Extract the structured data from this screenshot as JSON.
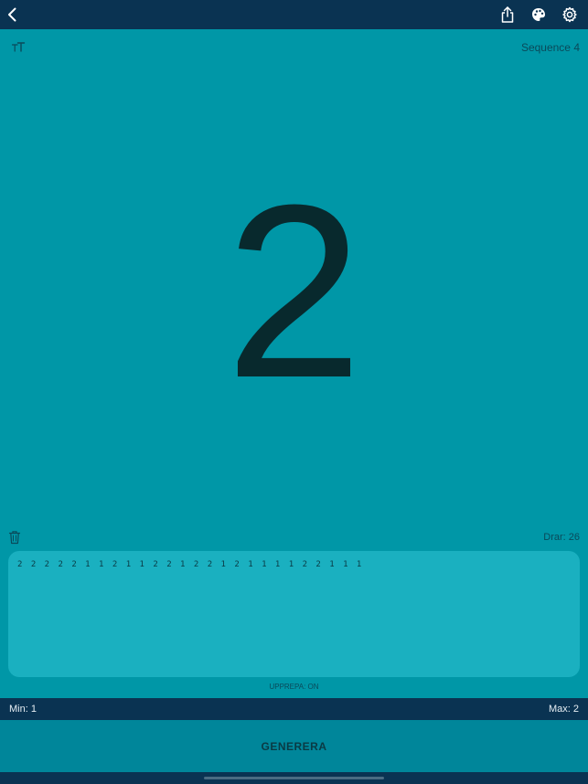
{
  "header": {
    "icons": [
      "back-chevron-icon",
      "share-icon",
      "palette-icon",
      "gear-icon"
    ]
  },
  "main": {
    "sequence_label": "Sequence 4",
    "current_number": "2",
    "draws_label": "Drar: 26",
    "history_text": "2 2 2 2 2 1 1 2 1 1 2 2 1 2 2 1 2 1 1 1 1 2 2 1 1 1",
    "repeat_label": "UPPREPA: ON"
  },
  "range": {
    "min_label": "Min: 1",
    "max_label": "Max: 2"
  },
  "actions": {
    "generate_label": "GENERERA"
  },
  "colors": {
    "background": "#0097a7",
    "topbar": "#0a3352",
    "history_box": "#1ab0c0",
    "generate_button": "#00869a",
    "number": "#08292d"
  }
}
